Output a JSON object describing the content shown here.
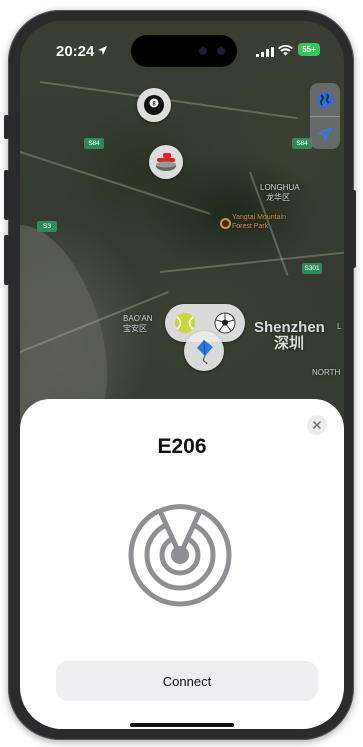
{
  "status_bar": {
    "time": "20:24",
    "battery": "55+"
  },
  "map": {
    "labels": {
      "longhua_en": "LONGHUA",
      "longhua_cn": "龙华区",
      "baoan_en": "BAO'AN",
      "baoan_cn": "宝安区",
      "city_en": "Shenzhen",
      "city_cn": "深圳",
      "north": "NORTH",
      "edge": "L"
    },
    "highway_shields": [
      "S84",
      "S84",
      "S3",
      "S301"
    ],
    "poi_label_1": "Yangtai Mountain",
    "poi_label_2": "Forest Park"
  },
  "map_controls": {
    "globe_icon": "globe-icon",
    "location_icon": "location-arrow-icon"
  },
  "pins": [
    {
      "icon": "billiard-ball-icon"
    },
    {
      "icon": "curling-stone-icon"
    },
    {
      "icon": "tennis-ball-icon"
    },
    {
      "icon": "soccer-ball-icon"
    },
    {
      "icon": "kite-icon"
    }
  ],
  "sheet": {
    "title": "E206",
    "connect_label": "Connect",
    "close_icon": "close-icon",
    "radar_icon": "radar-icon"
  },
  "colors": {
    "battery": "#34c759",
    "highway": "#2f8a5a",
    "poi": "#e08a4a",
    "radar": "#8e8e93"
  }
}
